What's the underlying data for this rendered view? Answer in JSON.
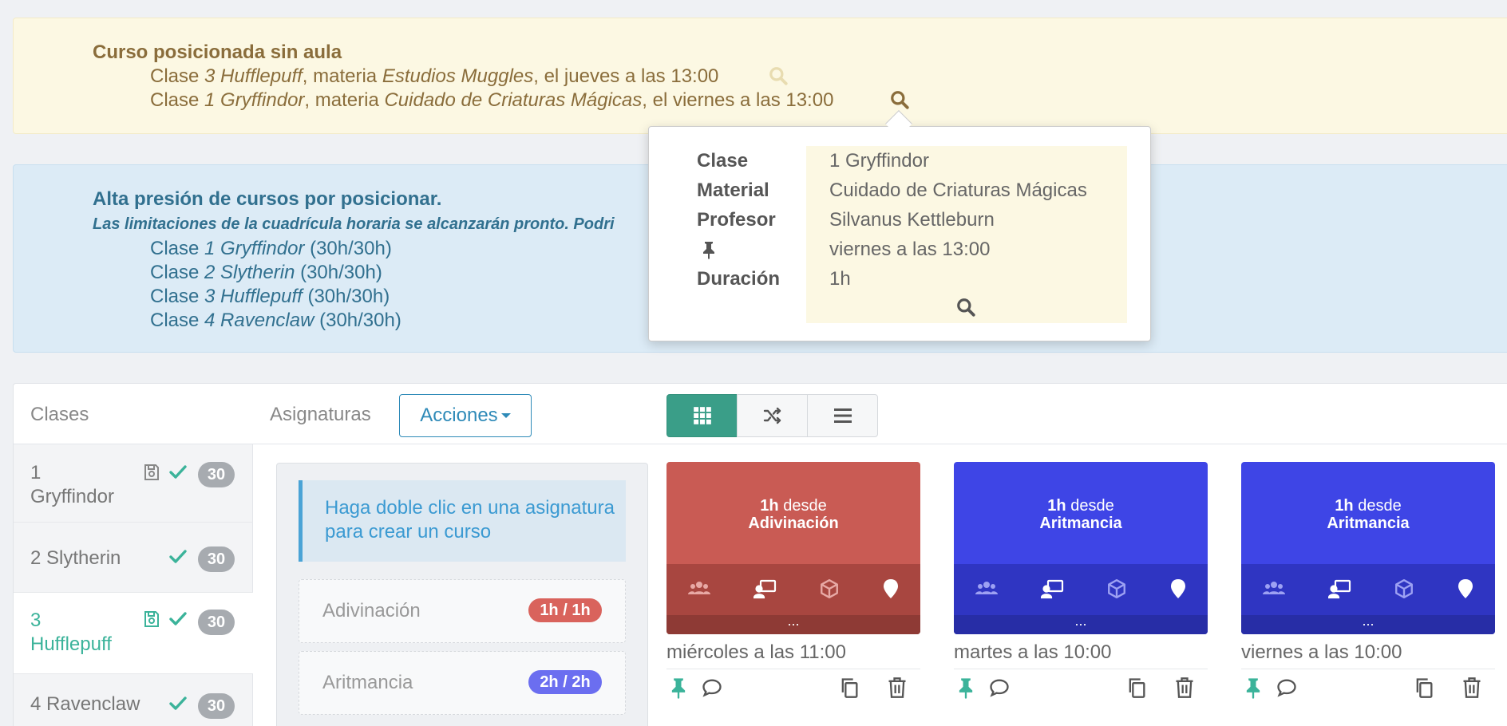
{
  "warning": {
    "title": "Curso posicionada sin aula",
    "lines": [
      {
        "p1": "Clase ",
        "cls": "3 Hufflepuff",
        "p2": ", materia ",
        "subj": "Estudios Muggles",
        "p3": ", el jueves a las 13:00"
      },
      {
        "p1": "Clase ",
        "cls": "1 Gryffindor",
        "p2": ", materia ",
        "subj": "Cuidado de Criaturas Mágicas",
        "p3": ", el viernes a las 13:00"
      }
    ]
  },
  "pressure": {
    "title": "Alta presión de cursos por posicionar.",
    "subtitle": "Las limitaciones de la cuadrícula horaria se alcanzarán pronto. Podri",
    "lines": [
      {
        "p1": "Clase ",
        "cls": "1 Gryffindor",
        "p3": " (30h/30h)"
      },
      {
        "p1": "Clase ",
        "cls": "2 Slytherin",
        "p3": " (30h/30h)"
      },
      {
        "p1": "Clase ",
        "cls": "3 Hufflepuff",
        "p3": " (30h/30h)"
      },
      {
        "p1": "Clase ",
        "cls": "4 Ravenclaw",
        "p3": " (30h/30h)"
      }
    ]
  },
  "popover": {
    "labels": {
      "clase": "Clase",
      "material": "Material",
      "profesor": "Profesor",
      "duracion": "Duración"
    },
    "values": {
      "clase": "1 Gryffindor",
      "material": "Cuidado de Criaturas Mágicas",
      "profesor": "Silvanus Kettleburn",
      "when": "viernes a las 13:00",
      "duracion": "1h"
    }
  },
  "toolbar": {
    "clases_label": "Clases",
    "asignaturas_label": "Asignaturas",
    "acciones_label": "Acciones"
  },
  "classes": [
    {
      "name_line1": "1",
      "name_line2": "Gryffindor",
      "count": "30"
    },
    {
      "name_line1": "2 Slytherin",
      "name_line2": "",
      "count": "30"
    },
    {
      "name_line1": "3",
      "name_line2": "Hufflepuff",
      "count": "30"
    },
    {
      "name_line1": "4 Ravenclaw",
      "name_line2": "",
      "count": "30"
    }
  ],
  "hint": "Haga doble clic en una asignatura para crear un curso",
  "subjects": [
    {
      "name": "Adivinación",
      "hours": "1h / 1h",
      "color": "#d9635c"
    },
    {
      "name": "Aritmancia",
      "hours": "2h / 2h",
      "color": "#6b6ef0"
    }
  ],
  "courses": [
    {
      "duration": "1h",
      "from_word": " desde",
      "subject": "Adivinación",
      "when": "miércoles a las 11:00",
      "top_color": "#c95b54",
      "bot_color": "#a84640"
    },
    {
      "duration": "1h",
      "from_word": " desde",
      "subject": "Aritmancia",
      "when": "martes a las 10:00",
      "top_color": "#3e45e6",
      "bot_color": "#2f35c2"
    },
    {
      "duration": "1h",
      "from_word": " desde",
      "subject": "Aritmancia",
      "when": "viernes a las 10:00",
      "top_color": "#3e45e6",
      "bot_color": "#2f35c2"
    }
  ],
  "card_dots": "...",
  "colors": {
    "accent": "#3bb39a",
    "primary": "#2e8ab8",
    "warning_text": "#8a6d3b",
    "info_text": "#31708f"
  }
}
